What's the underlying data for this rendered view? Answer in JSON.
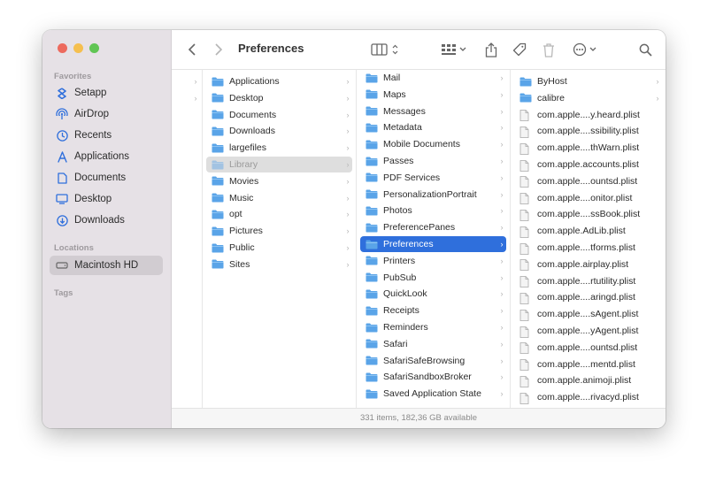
{
  "window": {
    "title": "Preferences",
    "status": "331 items, 182,36 GB available"
  },
  "colors": {
    "accent": "#2f6fdc",
    "folder": "#5aa4e8",
    "close": "#ed6a5e",
    "minimize": "#f5bf4f",
    "maximize": "#61c554"
  },
  "sidebar": {
    "favorites_label": "Favorites",
    "favorites": [
      {
        "label": "Setapp",
        "icon": "setapp-icon"
      },
      {
        "label": "AirDrop",
        "icon": "airdrop-icon"
      },
      {
        "label": "Recents",
        "icon": "clock-icon"
      },
      {
        "label": "Applications",
        "icon": "applications-icon"
      },
      {
        "label": "Documents",
        "icon": "document-icon"
      },
      {
        "label": "Desktop",
        "icon": "desktop-icon"
      },
      {
        "label": "Downloads",
        "icon": "download-icon"
      }
    ],
    "locations_label": "Locations",
    "locations": [
      {
        "label": "Macintosh HD",
        "icon": "disk-icon",
        "selected": true
      }
    ],
    "tags_label": "Tags"
  },
  "toolbar": {
    "back_icon": "chevron-left-icon",
    "forward_icon": "chevron-right-icon",
    "view_icon": "column-view-icon",
    "group_icon": "group-icon",
    "share_icon": "share-icon",
    "tag_icon": "tag-icon",
    "trash_icon": "trash-icon",
    "more_icon": "more-icon",
    "search_icon": "search-icon"
  },
  "columns": [
    {
      "items": [
        {
          "name": "",
          "folder": false,
          "chevron": true
        },
        {
          "name": "",
          "folder": false,
          "chevron": true
        }
      ]
    },
    {
      "items": [
        {
          "name": "Applications",
          "folder": true,
          "chevron": true
        },
        {
          "name": "Desktop",
          "folder": true,
          "chevron": true
        },
        {
          "name": "Documents",
          "folder": true,
          "chevron": true
        },
        {
          "name": "Downloads",
          "folder": true,
          "chevron": true
        },
        {
          "name": "largefiles",
          "folder": true,
          "chevron": true
        },
        {
          "name": "Library",
          "folder": true,
          "chevron": true,
          "dim": true
        },
        {
          "name": "Movies",
          "folder": true,
          "chevron": true
        },
        {
          "name": "Music",
          "folder": true,
          "chevron": true
        },
        {
          "name": "opt",
          "folder": true,
          "chevron": true
        },
        {
          "name": "Pictures",
          "folder": true,
          "chevron": true
        },
        {
          "name": "Public",
          "folder": true,
          "chevron": true
        },
        {
          "name": "Sites",
          "folder": true,
          "chevron": true
        }
      ]
    },
    {
      "items": [
        {
          "name": "Mail",
          "folder": true,
          "chevron": true
        },
        {
          "name": "Maps",
          "folder": true,
          "chevron": true
        },
        {
          "name": "Messages",
          "folder": true,
          "chevron": true
        },
        {
          "name": "Metadata",
          "folder": true,
          "chevron": true
        },
        {
          "name": "Mobile Documents",
          "folder": true,
          "chevron": true
        },
        {
          "name": "Passes",
          "folder": true,
          "chevron": true
        },
        {
          "name": "PDF Services",
          "folder": true,
          "chevron": true
        },
        {
          "name": "PersonalizationPortrait",
          "folder": true,
          "chevron": true
        },
        {
          "name": "Photos",
          "folder": true,
          "chevron": true
        },
        {
          "name": "PreferencePanes",
          "folder": true,
          "chevron": true
        },
        {
          "name": "Preferences",
          "folder": true,
          "chevron": true,
          "selected": true
        },
        {
          "name": "Printers",
          "folder": true,
          "chevron": true
        },
        {
          "name": "PubSub",
          "folder": true,
          "chevron": true
        },
        {
          "name": "QuickLook",
          "folder": true,
          "chevron": true
        },
        {
          "name": "Receipts",
          "folder": true,
          "chevron": true
        },
        {
          "name": "Reminders",
          "folder": true,
          "chevron": true
        },
        {
          "name": "Safari",
          "folder": true,
          "chevron": true
        },
        {
          "name": "SafariSafeBrowsing",
          "folder": true,
          "chevron": true
        },
        {
          "name": "SafariSandboxBroker",
          "folder": true,
          "chevron": true
        },
        {
          "name": "Saved Application State",
          "folder": true,
          "chevron": true
        }
      ]
    },
    {
      "items": [
        {
          "name": "ByHost",
          "folder": true,
          "chevron": true
        },
        {
          "name": "calibre",
          "folder": true,
          "chevron": true
        },
        {
          "name": "com.apple....y.heard.plist",
          "folder": false
        },
        {
          "name": "com.apple....ssibility.plist",
          "folder": false
        },
        {
          "name": "com.apple....thWarn.plist",
          "folder": false
        },
        {
          "name": "com.apple.accounts.plist",
          "folder": false
        },
        {
          "name": "com.apple....ountsd.plist",
          "folder": false
        },
        {
          "name": "com.apple....onitor.plist",
          "folder": false
        },
        {
          "name": "com.apple....ssBook.plist",
          "folder": false
        },
        {
          "name": "com.apple.AdLib.plist",
          "folder": false
        },
        {
          "name": "com.apple....tforms.plist",
          "folder": false
        },
        {
          "name": "com.apple.airplay.plist",
          "folder": false
        },
        {
          "name": "com.apple....rtutility.plist",
          "folder": false
        },
        {
          "name": "com.apple....aringd.plist",
          "folder": false
        },
        {
          "name": "com.apple....sAgent.plist",
          "folder": false
        },
        {
          "name": "com.apple....yAgent.plist",
          "folder": false
        },
        {
          "name": "com.apple....ountsd.plist",
          "folder": false
        },
        {
          "name": "com.apple....mentd.plist",
          "folder": false
        },
        {
          "name": "com.apple.animoji.plist",
          "folder": false
        },
        {
          "name": "com.apple....rivacyd.plist",
          "folder": false
        }
      ]
    }
  ]
}
